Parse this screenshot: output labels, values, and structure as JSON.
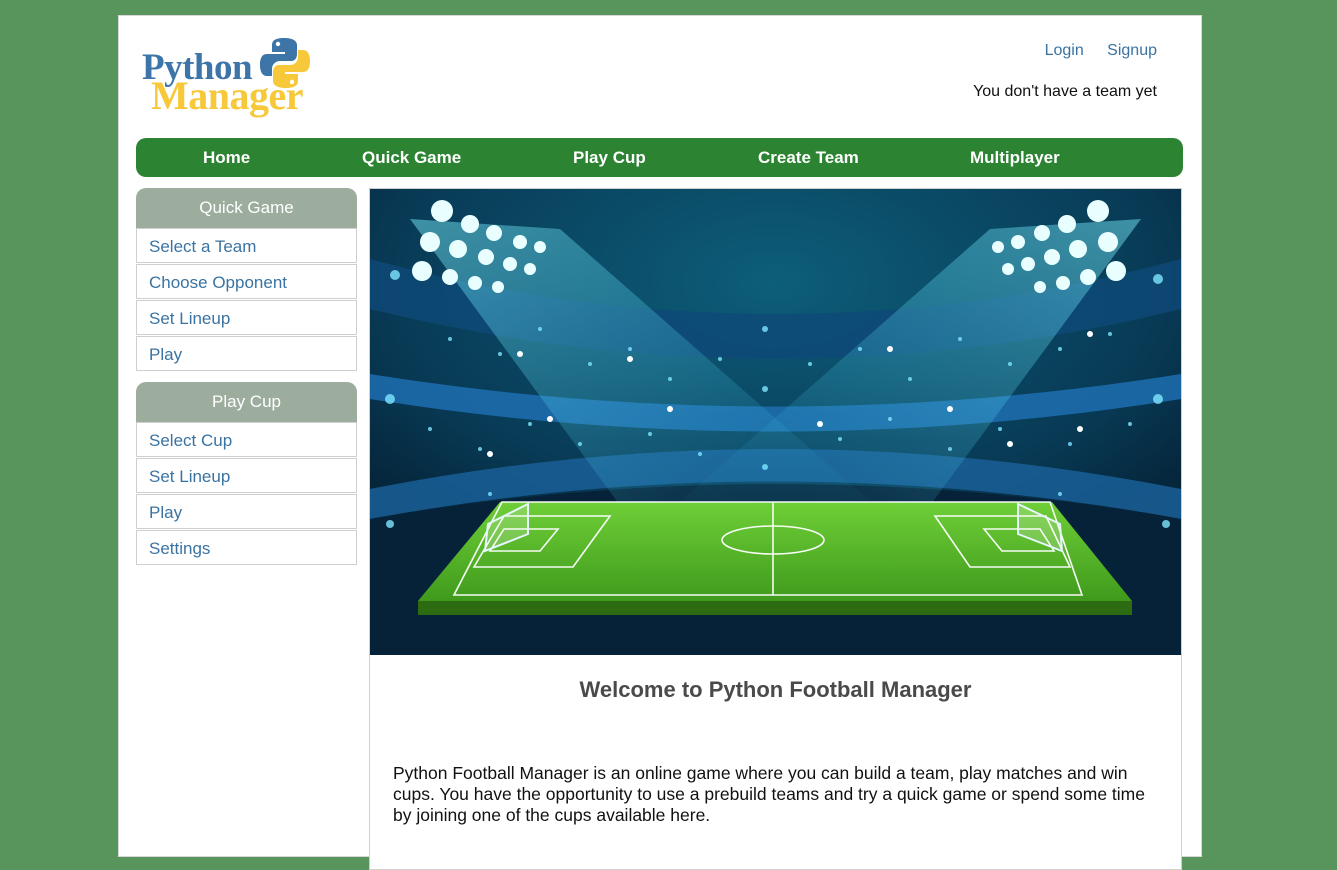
{
  "logo": {
    "word1": "Python",
    "word2": "Manager"
  },
  "header": {
    "login_label": "Login",
    "signup_label": "Signup",
    "team_status": "You don't have a team yet"
  },
  "nav": {
    "items": [
      {
        "label": "Home"
      },
      {
        "label": "Quick Game"
      },
      {
        "label": "Play Cup"
      },
      {
        "label": "Create Team"
      },
      {
        "label": "Multiplayer"
      }
    ]
  },
  "sidebar": {
    "quick_game": {
      "title": "Quick Game",
      "items": [
        {
          "label": "Select a Team"
        },
        {
          "label": "Choose Opponent"
        },
        {
          "label": "Set Lineup"
        },
        {
          "label": "Play"
        }
      ]
    },
    "play_cup": {
      "title": "Play Cup",
      "items": [
        {
          "label": "Select Cup"
        },
        {
          "label": "Set Lineup"
        },
        {
          "label": "Play"
        },
        {
          "label": "Settings"
        }
      ]
    }
  },
  "main": {
    "welcome_title": "Welcome to Python Football Manager",
    "intro_text": "Python Football Manager is an online game where you can build a team, play matches and win cups. You have the opportunity to use a prebuild teams and try a quick game or spend some time by joining one of the cups available here."
  },
  "colors": {
    "background": "#58955c",
    "nav_green": "#2c8432",
    "panel_header": "#9cad9e",
    "link_blue": "#3a73a1",
    "logo_blue": "#3d75a8",
    "logo_yellow": "#f7c93a"
  }
}
